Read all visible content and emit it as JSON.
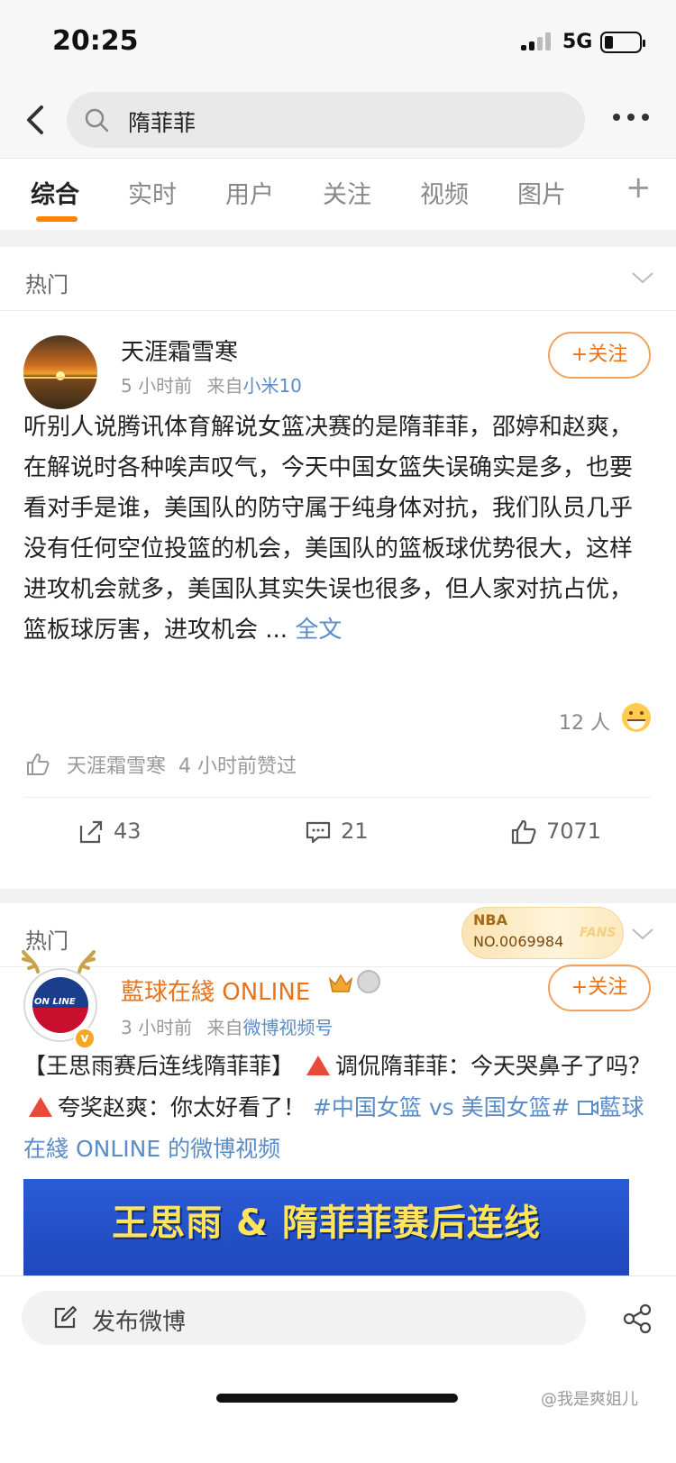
{
  "status_bar": {
    "time": "20:25",
    "network": "5G"
  },
  "search": {
    "query": "隋菲菲"
  },
  "tabs": [
    {
      "label": "综合"
    },
    {
      "label": "实时"
    },
    {
      "label": "用户"
    },
    {
      "label": "关注"
    },
    {
      "label": "视频"
    },
    {
      "label": "图片"
    }
  ],
  "tab_add": "+",
  "posts": [
    {
      "section": "热门",
      "author": "天涯霜雪寒",
      "time": "5 小时前",
      "source_prefix": "来自",
      "source": "小米10",
      "follow_label": "+关注",
      "text": "听别人说腾讯体育解说女篮决赛的是隋菲菲，邵婷和赵爽，在解说时各种唉声叹气，今天中国女篮失误确实是多，也要看对手是谁，美国队的防守属于纯身体对抗，我们队员几乎没有任何空位投篮的机会，美国队的篮板球优势很大，这样进攻机会就多，美国队其实失误也很多，但人家对抗占优，篮板球厉害，进攻机会 ...",
      "full_text_link": "全文",
      "reactions": "12 人",
      "liked_by": "天涯霜雪寒",
      "liked_time": "4 小时前赞过",
      "reposts": "43",
      "comments": "21",
      "likes": "7071"
    },
    {
      "section": "热门",
      "badge": {
        "title": "NBA",
        "number": "NO.0069984",
        "fans": "FANS"
      },
      "author": "藍球在綫 ONLINE",
      "avatar_text": "ON LINE",
      "time": "3 小时前",
      "source_prefix": "来自",
      "source": "微博视频号",
      "follow_label": "+关注",
      "text_part1": "【王思雨赛后连线隋菲菲】",
      "text_part2": "调侃隋菲菲：今天哭鼻子了吗？",
      "text_part3": "夸奖赵爽：你太好看了！",
      "hashtag": "#中国女篮 vs 美国女篮#",
      "video_link": "藍球在綫 ONLINE 的微博视频",
      "banner_title": "王思雨 & 隋菲菲赛后连线"
    }
  ],
  "compose": {
    "placeholder": "发布微博"
  },
  "watermark": "@我是爽姐儿"
}
